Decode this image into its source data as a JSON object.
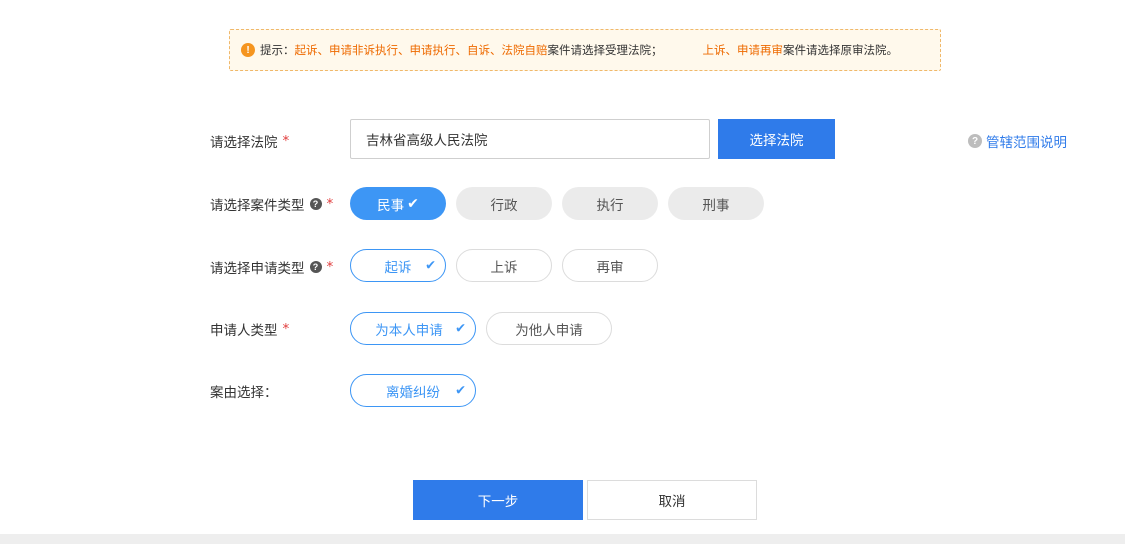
{
  "notice": {
    "prefix": "提示：",
    "highlight1": "起诉、申请非诉执行、申请执行、自诉、法院自赔",
    "text1": " 案件请选择受理法院；",
    "highlight2": "上诉、申请再审",
    "text2": " 案件请选择原审法院。"
  },
  "form": {
    "court": {
      "label": "请选择法院",
      "value": "吉林省高级人民法院",
      "button": "选择法院",
      "help_link": "管辖范围说明"
    },
    "case_type": {
      "label": "请选择案件类型",
      "options": [
        "民事",
        "行政",
        "执行",
        "刑事"
      ],
      "selected": "民事"
    },
    "apply_type": {
      "label": "请选择申请类型",
      "options": [
        "起诉",
        "上诉",
        "再审"
      ],
      "selected": "起诉"
    },
    "applicant_type": {
      "label": "申请人类型",
      "options": [
        "为本人申请",
        "为他人申请"
      ],
      "selected": "为本人申请"
    },
    "cause": {
      "label": "案由选择：",
      "value": "离婚纠纷"
    },
    "required_mark": "*"
  },
  "actions": {
    "next": "下一步",
    "cancel": "取消"
  },
  "colors": {
    "primary": "#2f7bea",
    "accent": "#3d96f5",
    "notice_highlight": "#ee6a00",
    "required": "#e03a3a"
  }
}
